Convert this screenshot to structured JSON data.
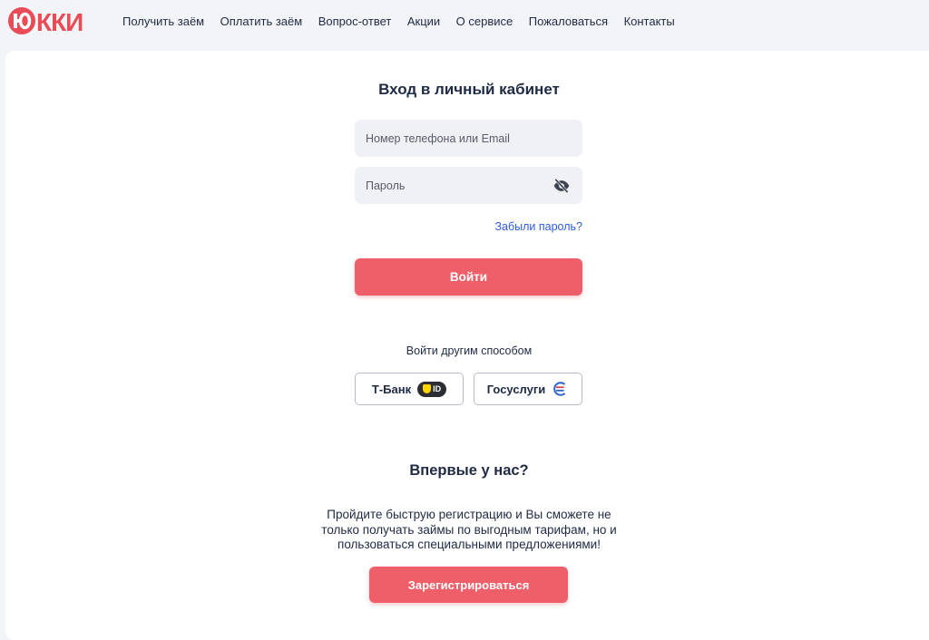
{
  "brand": {
    "name": "ЮККИ",
    "accent_color": "#ee5f69"
  },
  "nav": {
    "items": [
      {
        "label": "Получить заём"
      },
      {
        "label": "Оплатить заём"
      },
      {
        "label": "Вопрос-ответ"
      },
      {
        "label": "Акции"
      },
      {
        "label": "О сервисе"
      },
      {
        "label": "Пожаловаться"
      },
      {
        "label": "Контакты"
      }
    ]
  },
  "login": {
    "title": "Вход в личный кабинет",
    "login_placeholder": "Номер телефона или Email",
    "password_placeholder": "Пароль",
    "password_toggle_icon": "eye-off-icon",
    "forgot_label": "Забыли пароль?",
    "submit_label": "Войти",
    "submit_color": "#ee5f69"
  },
  "alt_login": {
    "label": "Войти другим способом",
    "tbank": {
      "label": "Т-Банк",
      "badge": "ID"
    },
    "gosuslugi": {
      "label": "Госуслуги",
      "icon": "gosuslugi-icon"
    }
  },
  "register": {
    "title": "Впервые у нас?",
    "text": "Пройдите быструю регистрацию и Вы сможете не только получать займы по выгодным тарифам, но и пользоваться специальными предложениями!",
    "button_label": "Зарегистрироваться"
  }
}
